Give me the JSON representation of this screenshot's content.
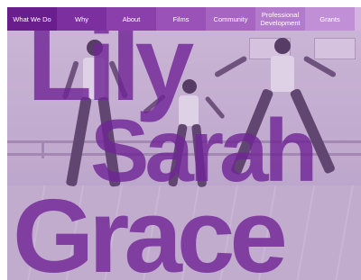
{
  "nav": {
    "items": [
      {
        "label": "What We Do"
      },
      {
        "label": "Why"
      },
      {
        "label": "About"
      },
      {
        "label": "Films"
      },
      {
        "label": "Community"
      },
      {
        "label": "Professional Development"
      },
      {
        "label": "Grants"
      },
      {
        "label": ""
      }
    ]
  },
  "hero": {
    "names": [
      "Lily",
      "Sarah",
      "Grace"
    ]
  },
  "colors": {
    "brand_purple": "#6a1e8d",
    "name_overlay": "#7026a0"
  }
}
